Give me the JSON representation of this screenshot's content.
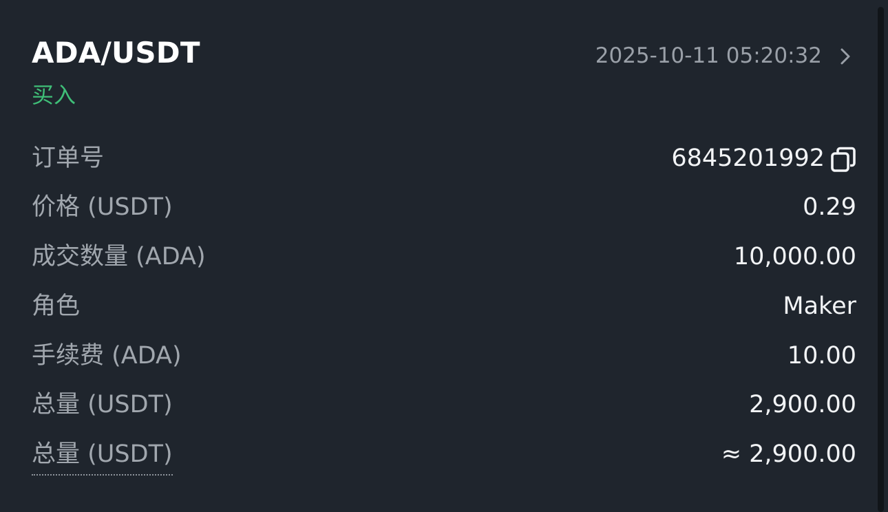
{
  "header": {
    "pair": "ADA/USDT",
    "side": "买入",
    "datetime": "2025-10-11 05:20:32"
  },
  "details": [
    {
      "label": "订单号",
      "value": "6845201992"
    },
    {
      "label": "价格 (USDT)",
      "value": "0.29"
    },
    {
      "label": "成交数量 (ADA)",
      "value": "10,000.00"
    },
    {
      "label": "角色",
      "value": "Maker"
    },
    {
      "label": "手续费 (ADA)",
      "value": "10.00"
    },
    {
      "label": "总量 (USDT)",
      "value": "2,900.00"
    },
    {
      "label": "总量 (USDT)",
      "value": "≈ 2,900.00"
    }
  ],
  "icons": {
    "detail_chevron": "chevron-right-icon",
    "copy": "copy-icon"
  },
  "colors": {
    "background": "#1f252d",
    "buy": "#3fbf78",
    "label": "#a1a7ae",
    "value": "#f2f4f6",
    "muted": "#9aa0a8"
  }
}
